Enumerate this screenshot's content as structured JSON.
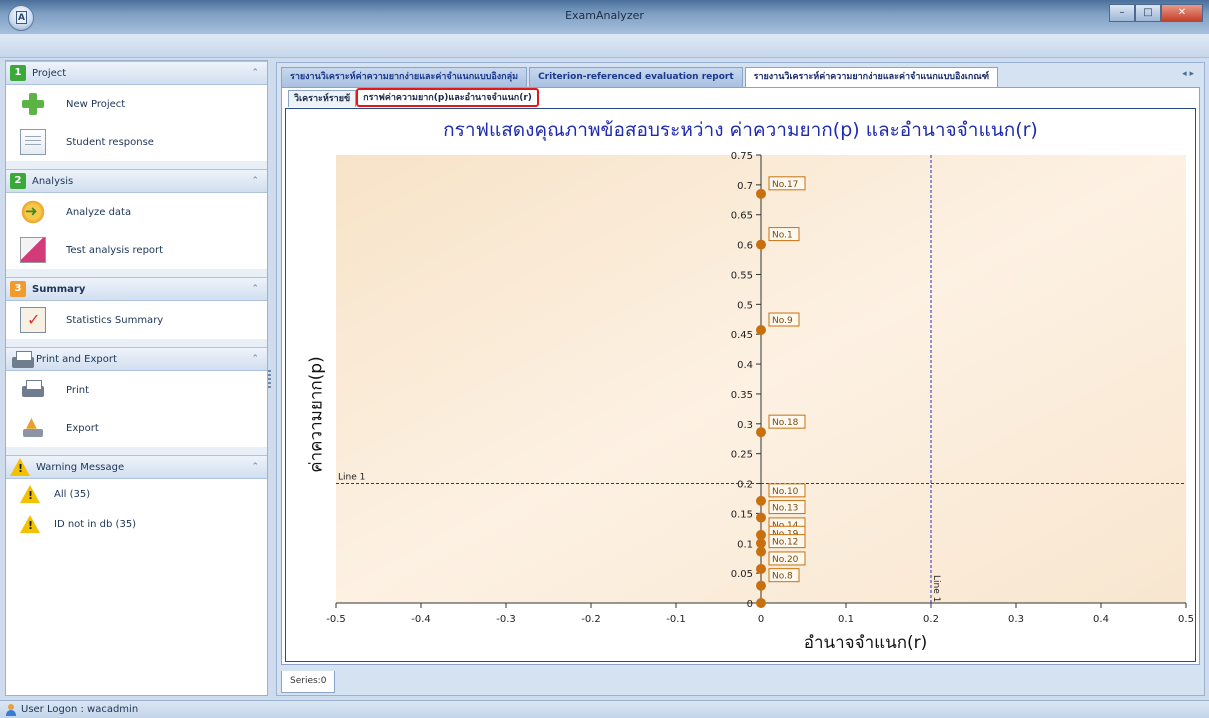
{
  "window": {
    "title": "ExamAnalyzer",
    "app_button_letter": "A"
  },
  "nav": {
    "project": {
      "num": "1",
      "title": "Project",
      "items": [
        {
          "label": "New Project",
          "icon": "new-project-icon"
        },
        {
          "label": "Student response",
          "icon": "document-icon"
        }
      ]
    },
    "analysis": {
      "num": "2",
      "title": "Analysis",
      "items": [
        {
          "label": "Analyze data",
          "icon": "analyze-icon"
        },
        {
          "label": "Test analysis report",
          "icon": "report-icon"
        }
      ]
    },
    "summary": {
      "num": "3",
      "title": "Summary",
      "items": [
        {
          "label": "Statistics Summary",
          "icon": "clipboard-icon"
        }
      ]
    },
    "print_export": {
      "title": "Print and Export",
      "items": [
        {
          "label": "Print",
          "icon": "printer-icon"
        },
        {
          "label": "Export",
          "icon": "export-icon"
        }
      ]
    },
    "warning": {
      "title": "Warning Message",
      "items": [
        {
          "label": "All (35)",
          "icon": "warning-icon"
        },
        {
          "label": "ID not in db (35)",
          "icon": "warning-icon"
        }
      ]
    }
  },
  "main": {
    "tabs": [
      {
        "label": "รายงานวิเคราะห์ค่าความยากง่ายและค่าจำแนกแบบอิงกลุ่ม"
      },
      {
        "label": "Criterion-referenced evaluation report"
      },
      {
        "label": "รายงานวิเคราะห์ค่าความยากง่ายและค่าจำแนกแบบอิงเกณฑ์"
      }
    ],
    "subtabs": [
      {
        "label": "วิเคราะห์รายข้"
      },
      {
        "label": "กราฟค่าความยาก(p)และอำนาจจำแนก(r)"
      }
    ],
    "bottom_tab": "Series:0"
  },
  "chart_data": {
    "type": "scatter",
    "title": "กราฟแสดงคุณภาพข้อสอบระหว่าง ค่าความยาก(p) และอำนาจจำแนก(r)",
    "xlabel": "อำนาจจำแนก(r)",
    "ylabel": "ค่าความยาก(p)",
    "xlim": [
      -0.5,
      0.5
    ],
    "ylim": [
      0,
      0.75
    ],
    "x_ticks": [
      "-0.5",
      "-0.4",
      "-0.3",
      "-0.2",
      "-0.1",
      "0",
      "0.1",
      "0.2",
      "0.3",
      "0.4",
      "0.5"
    ],
    "y_ticks": [
      "0",
      "0.05",
      "0.1",
      "0.15",
      "0.2",
      "0.25",
      "0.3",
      "0.35",
      "0.4",
      "0.45",
      "0.5",
      "0.55",
      "0.6",
      "0.65",
      "0.7",
      "0.75"
    ],
    "points": [
      {
        "label": "No.17",
        "x": 0,
        "y": 0.685
      },
      {
        "label": "No.1",
        "x": 0,
        "y": 0.6
      },
      {
        "label": "No.9",
        "x": 0,
        "y": 0.457
      },
      {
        "label": "No.18",
        "x": 0,
        "y": 0.286
      },
      {
        "label": "No.10",
        "x": 0,
        "y": 0.171
      },
      {
        "label": "No.13",
        "x": 0,
        "y": 0.143
      },
      {
        "label": "No.14",
        "x": 0,
        "y": 0.114
      },
      {
        "label": "No.19",
        "x": 0,
        "y": 0.1
      },
      {
        "label": "No.12",
        "x": 0,
        "y": 0.086
      },
      {
        "label": "No.20",
        "x": 0,
        "y": 0.057
      },
      {
        "label": "No.8",
        "x": 0,
        "y": 0.029
      },
      {
        "label": "",
        "x": 0,
        "y": 0
      }
    ],
    "reference_lines": [
      {
        "label": "Line 1",
        "axis": "y",
        "value": 0.2
      },
      {
        "label": "Line 1",
        "axis": "x",
        "value": 0.2
      }
    ],
    "grid": false,
    "colors": {
      "point": "#c8700f",
      "label_border": "#c8700f",
      "reference_line": "#2230c8",
      "plot_bg": "#fdf1e3",
      "title": "#1f2bb0"
    }
  },
  "status": {
    "user_logon": "User Logon : wacadmin"
  }
}
